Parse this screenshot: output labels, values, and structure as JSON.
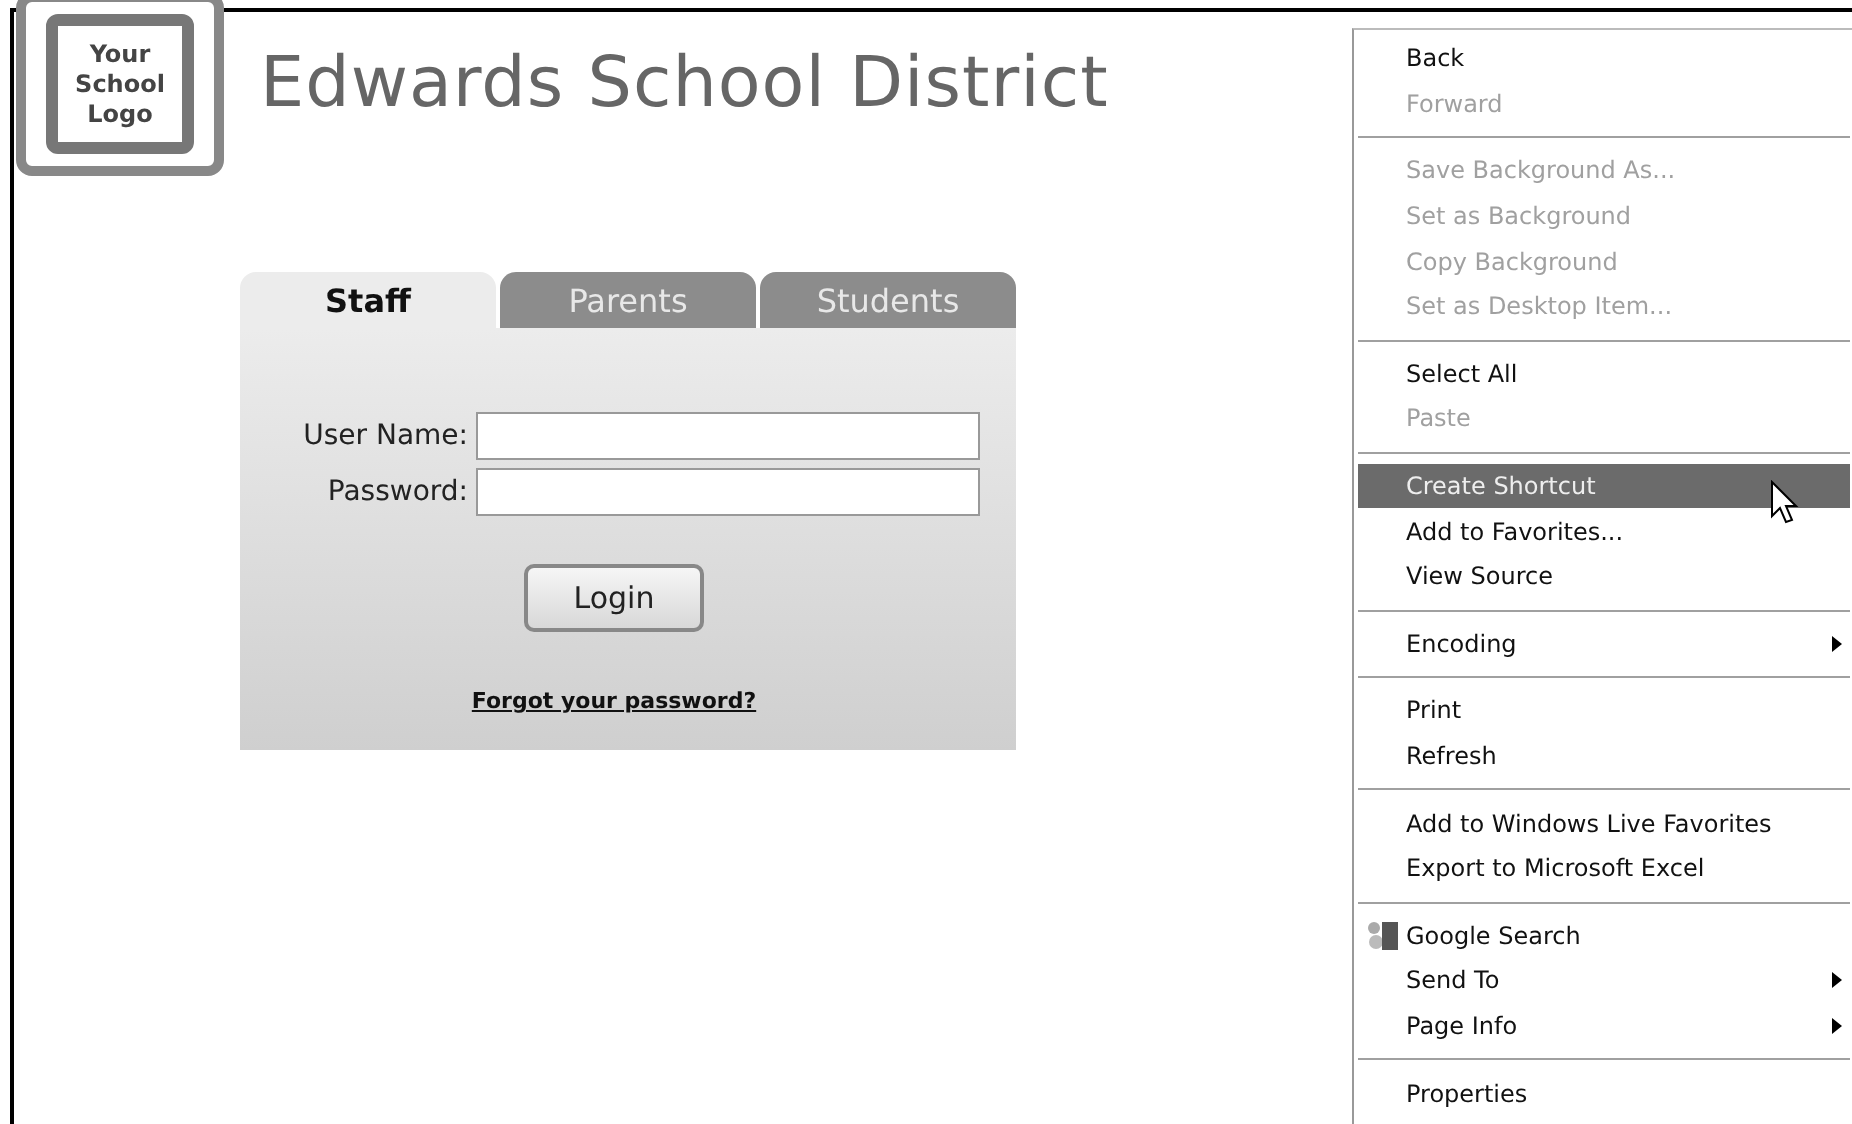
{
  "logo": {
    "lines": [
      "Your",
      "School",
      "Logo"
    ]
  },
  "title": "Edwards School District",
  "login": {
    "tabs": [
      {
        "label": "Staff",
        "selected": true
      },
      {
        "label": "Parents",
        "selected": false
      },
      {
        "label": "Students",
        "selected": false
      }
    ],
    "fields": [
      {
        "label": "User Name:"
      },
      {
        "label": "Password:"
      }
    ],
    "button": "Login",
    "forgot_link": "Forgot your password?"
  },
  "context_menu": {
    "groups": [
      [
        {
          "label": "Back",
          "disabled": false,
          "selected": false,
          "submenu": false,
          "kind": "plain"
        },
        {
          "label": "Forward",
          "disabled": true,
          "selected": false,
          "submenu": false,
          "kind": "plain"
        }
      ],
      [
        {
          "label": "Save Background As...",
          "disabled": true,
          "selected": false,
          "submenu": false,
          "kind": "plain"
        },
        {
          "label": "Set as Background",
          "disabled": true,
          "selected": false,
          "submenu": false,
          "kind": "plain"
        },
        {
          "label": "Copy Background",
          "disabled": true,
          "selected": false,
          "submenu": false,
          "kind": "plain"
        },
        {
          "label": "Set as Desktop Item...",
          "disabled": true,
          "selected": false,
          "submenu": false,
          "kind": "plain"
        }
      ],
      [
        {
          "label": "Select All",
          "disabled": false,
          "selected": false,
          "submenu": false,
          "kind": "plain"
        },
        {
          "label": "Paste",
          "disabled": true,
          "selected": false,
          "submenu": false,
          "kind": "plain"
        }
      ],
      [
        {
          "label": "Create Shortcut",
          "disabled": false,
          "selected": true,
          "submenu": false,
          "kind": "plain"
        },
        {
          "label": "Add to Favorites...",
          "disabled": false,
          "selected": false,
          "submenu": false,
          "kind": "plain"
        },
        {
          "label": "View Source",
          "disabled": false,
          "selected": false,
          "submenu": false,
          "kind": "plain"
        }
      ],
      [
        {
          "label": "Encoding",
          "disabled": false,
          "selected": false,
          "submenu": true,
          "kind": "plain"
        }
      ],
      [
        {
          "label": "Print",
          "disabled": false,
          "selected": false,
          "submenu": false,
          "kind": "plain"
        },
        {
          "label": "Refresh",
          "disabled": false,
          "selected": false,
          "submenu": false,
          "kind": "plain"
        }
      ],
      [
        {
          "label": "Add to Windows Live Favorites",
          "disabled": false,
          "selected": false,
          "submenu": false,
          "kind": "plain"
        },
        {
          "label": "Export to Microsoft Excel",
          "disabled": false,
          "selected": false,
          "submenu": false,
          "kind": "plain"
        }
      ],
      [
        {
          "label": "Google Search",
          "disabled": false,
          "selected": false,
          "submenu": false,
          "kind": "icon"
        },
        {
          "label": "Send To",
          "disabled": false,
          "selected": false,
          "submenu": true,
          "kind": "plain"
        },
        {
          "label": "Page Info",
          "disabled": false,
          "selected": false,
          "submenu": true,
          "kind": "plain"
        }
      ],
      [
        {
          "label": "Properties",
          "disabled": false,
          "selected": false,
          "submenu": false,
          "kind": "plain"
        }
      ]
    ]
  }
}
